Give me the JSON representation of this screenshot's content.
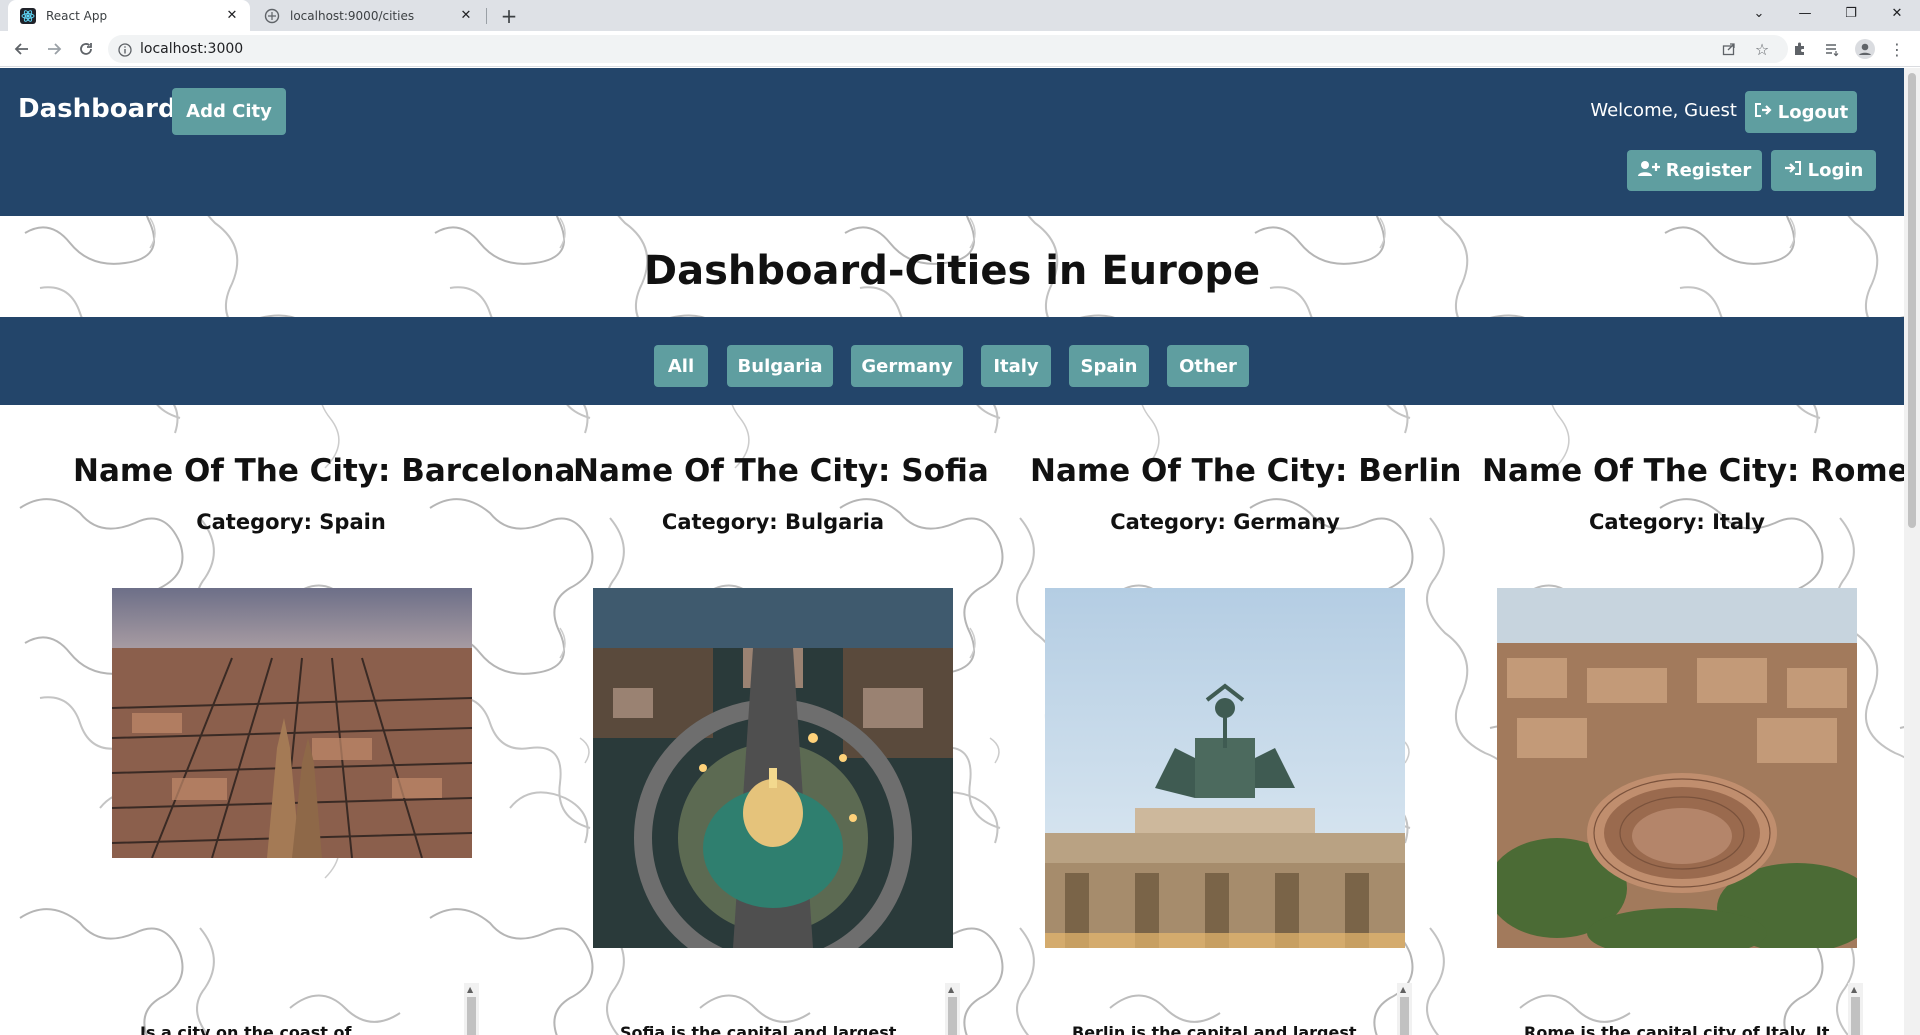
{
  "browser": {
    "tabs": [
      {
        "title": "React App",
        "favicon": "react-icon",
        "active": true
      },
      {
        "title": "localhost:9000/cities",
        "favicon": "page-icon",
        "active": false
      }
    ],
    "address": "localhost:3000"
  },
  "navbar": {
    "brand": "Dashboard",
    "add_city": "Add City",
    "welcome": "Welcome, Guest",
    "logout": "Logout",
    "register": "Register",
    "login": "Login"
  },
  "page": {
    "heading": "Dashboard-Cities in Europe"
  },
  "filters": [
    "All",
    "Bulgaria",
    "Germany",
    "Italy",
    "Spain",
    "Other"
  ],
  "cards": [
    {
      "title": "Name Of The City: Barcelona",
      "category": "Category: Spain",
      "description": "Is a city on the coast of",
      "image": "barcelona-aerial"
    },
    {
      "title": "Name Of The City: Sofia",
      "category": "Category: Bulgaria",
      "description": "Sofia is the capital and largest",
      "image": "sofia-cathedral"
    },
    {
      "title": "Name Of The City: Berlin",
      "category": "Category: Germany",
      "description": "Berlin is the capital and largest",
      "image": "brandenburg-gate"
    },
    {
      "title": "Name Of The City: Rome",
      "category": "Category: Italy",
      "description": "Rome is the capital city of Italy. It",
      "image": "colosseum-aerial"
    }
  ],
  "colors": {
    "navbar": "#23456a",
    "button": "#5f9ea0",
    "text": "#111111"
  }
}
